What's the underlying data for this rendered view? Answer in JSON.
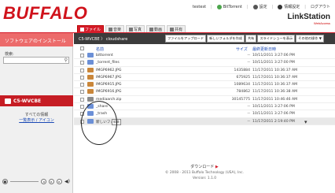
{
  "app": {
    "logo": "BUFFALO",
    "product": "LinkStation",
    "product_sub": "WebAccess",
    "top_links": [
      {
        "label": "testest",
        "icon": "user-icon"
      },
      {
        "label": "BitTorrent",
        "icon": "torrent-icon"
      },
      {
        "label": "設定",
        "icon": "gear-icon"
      },
      {
        "label": "情報設定",
        "icon": "info-icon"
      },
      {
        "label": "ログアウト",
        "icon": ""
      }
    ]
  },
  "tabs": [
    {
      "label": "ファイル",
      "icon": "folder-icon",
      "active": true
    },
    {
      "label": "音楽",
      "icon": "music-icon",
      "active": false
    },
    {
      "label": "写真",
      "icon": "photo-icon",
      "active": false
    },
    {
      "label": "動画",
      "icon": "video-icon",
      "active": false
    },
    {
      "label": "共有",
      "icon": "share-icon",
      "active": false
    }
  ],
  "sidebar": {
    "header": "ソフトウェアのインストール",
    "search_label": "検索:",
    "search_value": "",
    "selected_device": "C5-WVCBE",
    "all_info_line1": "すべての情報",
    "all_info_link": "一覧表示 / アイコン"
  },
  "toolbar": {
    "path": "C5-WVCBE 〉 cloudshare",
    "buttons": [
      "ファイルをアップロード",
      "新しいフォルダを作成",
      "共有",
      "スライドショーを表示",
      "その他の操作 ▼"
    ]
  },
  "table": {
    "headers": {
      "name": "名前",
      "size": "サイズ",
      "modified": "最終更新日時"
    },
    "rows": [
      {
        "name": "bittorrent",
        "size": "--",
        "date": "10/11/2011 3:27:06 PM",
        "kind": "folder"
      },
      {
        "name": "_torrent_files",
        "size": "--",
        "date": "10/11/2011 3:27:00 PM",
        "kind": "folder"
      },
      {
        "name": "IMGP6962.JPG",
        "size": "1435884",
        "date": "11/17/2011 10:36:37 AM",
        "kind": "image"
      },
      {
        "name": "IMGP6967.JPG",
        "size": "675925",
        "date": "11/17/2011 10:36:37 AM",
        "kind": "image"
      },
      {
        "name": "IMGP6915.JPG",
        "size": "1089634",
        "date": "11/17/2011 10:36:37 AM",
        "kind": "image"
      },
      {
        "name": "IMGP6916.JPG",
        "size": "784862",
        "date": "11/17/2011 10:36:38 AM",
        "kind": "image"
      },
      {
        "name": "mediaarch.zip",
        "size": "30145775",
        "date": "11/17/2011 10:46:46 AM",
        "kind": "file"
      },
      {
        "name": "_share",
        "size": "--",
        "date": "10/11/2011 3:27:06 PM",
        "kind": "folder"
      },
      {
        "name": "_trash",
        "size": "--",
        "date": "10/11/2011 3:27:06 PM",
        "kind": "folder"
      },
      {
        "name": "新しいフォルダ",
        "size": "--",
        "date": "11/17/2011 2:19:40 PM",
        "kind": "folder",
        "editing": true,
        "edit_label": "編集"
      }
    ]
  },
  "footer": {
    "download": "ダウンロード",
    "copyright": "© 2008 - 2011 Buffalo Technology (USA), Inc.",
    "version": "Version: 1.1.0"
  },
  "colors": {
    "accent": "#d51c2a",
    "folder": "#6b8fd6",
    "toolbar": "#3c3c3c"
  }
}
